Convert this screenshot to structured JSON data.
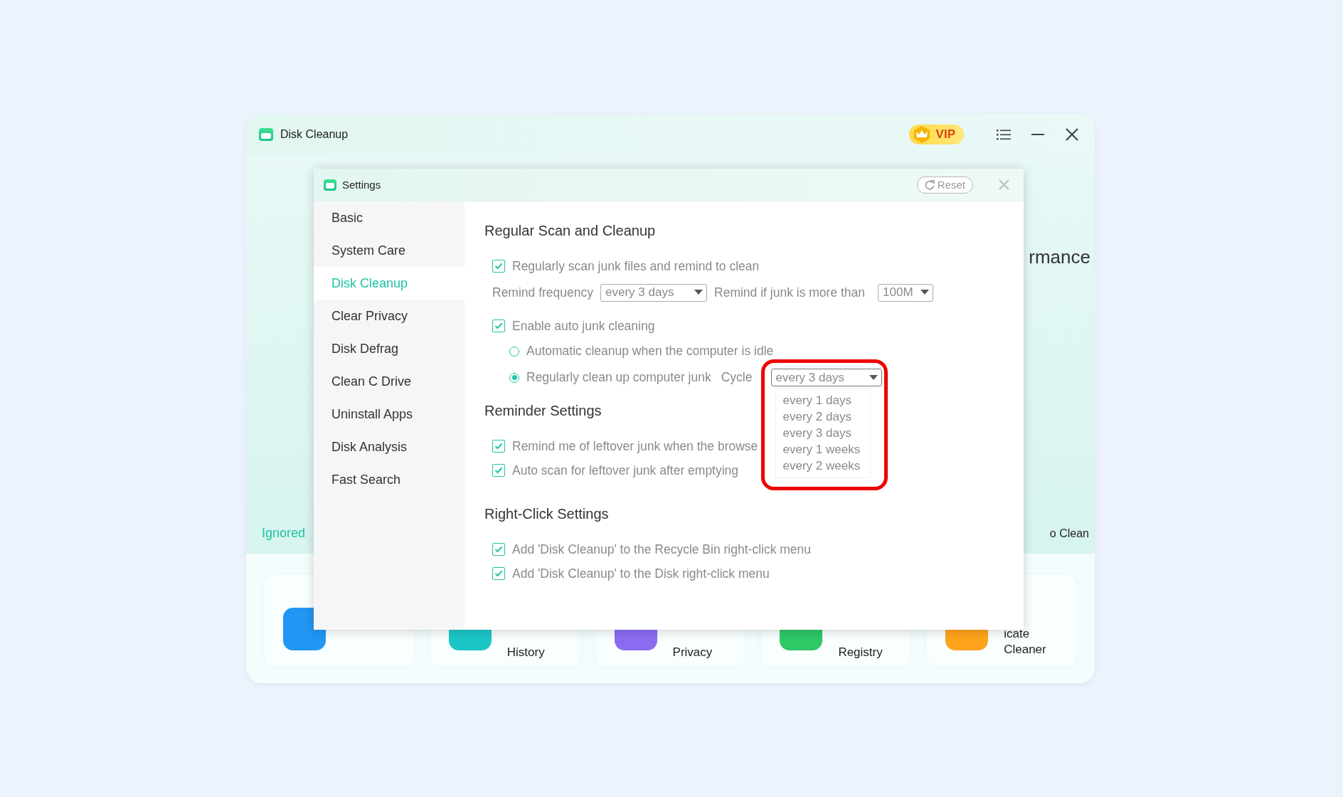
{
  "app_window": {
    "title": "Disk Cleanup",
    "vip_label": "VIP"
  },
  "background": {
    "headline_fragment": "rmance",
    "left_link": "Ignored",
    "right_label_fragment": "o Clean",
    "tools": [
      {
        "color": "#2196f3"
      },
      {
        "color": "#1cc6c6",
        "lines": [
          "History"
        ]
      },
      {
        "color": "#8b6cf0",
        "lines": [
          "Privacy"
        ]
      },
      {
        "color": "#2ec866",
        "lines": [
          "Registry"
        ]
      },
      {
        "color": "#ffa41c",
        "lines": [
          "icate",
          "Cleaner"
        ]
      }
    ]
  },
  "settings": {
    "title": "Settings",
    "reset": "Reset",
    "nav": [
      {
        "label": "Basic",
        "selected": false
      },
      {
        "label": "System Care",
        "selected": false
      },
      {
        "label": "Disk Cleanup",
        "selected": true
      },
      {
        "label": "Clear Privacy",
        "selected": false
      },
      {
        "label": "Disk Defrag",
        "selected": false
      },
      {
        "label": "Clean C Drive",
        "selected": false
      },
      {
        "label": "Uninstall Apps",
        "selected": false
      },
      {
        "label": "Disk Analysis",
        "selected": false
      },
      {
        "label": "Fast Search",
        "selected": false
      }
    ],
    "sections": [
      {
        "title": "Regular Scan and Cleanup",
        "items": [
          {
            "kind": "checkbox",
            "label": "Regularly scan junk files and remind to clean",
            "checked": true
          },
          {
            "kind": "selects",
            "fields": [
              {
                "label": "Remind frequency",
                "value": "every 3 days"
              },
              {
                "label": "Remind if junk is more than",
                "value": "100M"
              }
            ]
          },
          {
            "kind": "checkbox",
            "label": "Enable auto junk cleaning",
            "checked": true
          },
          {
            "kind": "radio",
            "label": "Automatic cleanup when the computer is idle",
            "selected": false
          },
          {
            "kind": "radio",
            "label": "Regularly clean up computer junk",
            "selected": true,
            "cycle": {
              "label": "Cycle",
              "value": "every 3 days",
              "expanded": true,
              "options": [
                "every 1 days",
                "every 2 days",
                "every 3 days",
                "every 1 weeks",
                "every 2 weeks"
              ]
            }
          }
        ]
      },
      {
        "title": "Reminder Settings",
        "items": [
          {
            "kind": "checkbox",
            "label": "Remind me of leftover junk when the browse",
            "checked": true
          },
          {
            "kind": "checkbox",
            "label": "Auto scan for leftover junk after emptying",
            "checked": true
          }
        ]
      },
      {
        "title": "Right-Click Settings",
        "items": [
          {
            "kind": "checkbox",
            "label": "Add 'Disk Cleanup' to the Recycle Bin right-click menu",
            "checked": true
          },
          {
            "kind": "checkbox",
            "label": "Add 'Disk Cleanup' to the Disk right-click menu",
            "checked": true
          }
        ]
      }
    ]
  }
}
